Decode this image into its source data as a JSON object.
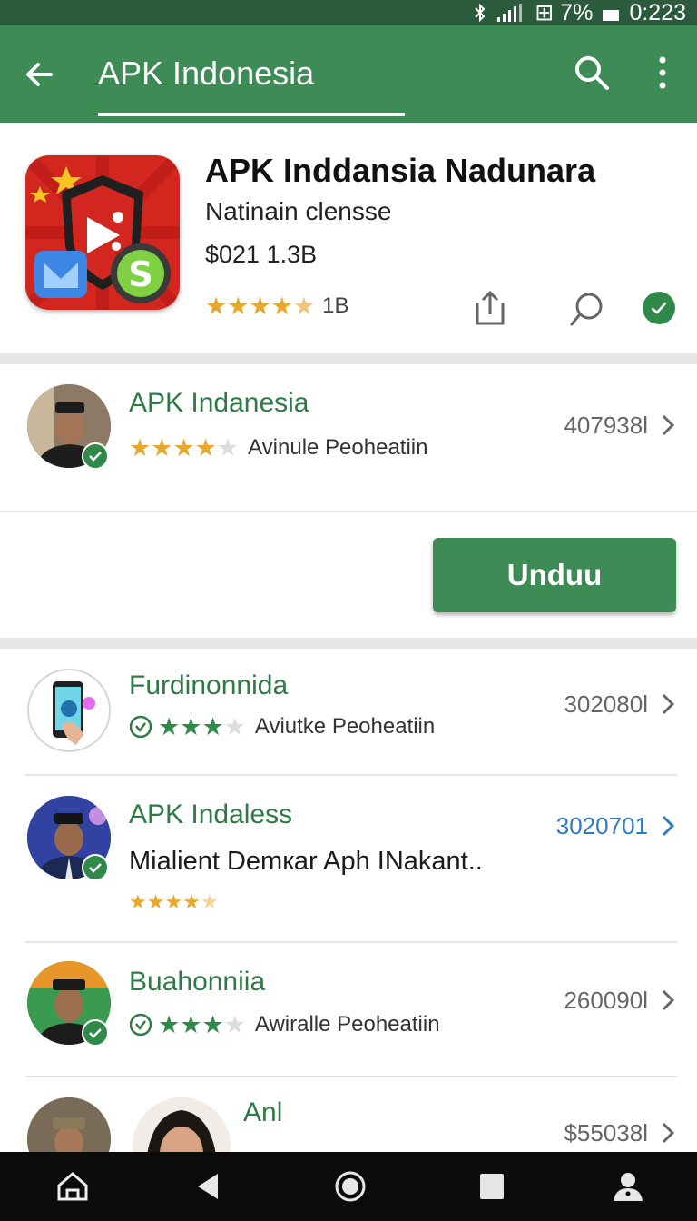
{
  "status_bar": {
    "battery": "⊞ 7%",
    "time": "0:223"
  },
  "app_bar": {
    "title": "APK Indonesia"
  },
  "hero": {
    "title": "APK Inddansia Nadunara",
    "subtitle": "Natinain clensse",
    "price": "$021 1.3B",
    "rating_count": "1B",
    "rating": 4.5
  },
  "listing1": {
    "title": "APK Indanesia",
    "subtitle": "Avinule Peoheatiin",
    "number": "407938l",
    "rating": 4
  },
  "download_button": {
    "label": "Unduu"
  },
  "list": [
    {
      "title": "Furdinonnida",
      "subtitle": "Aviutke Peoheatiin",
      "number": "302080l",
      "rating": 3
    },
    {
      "title": "APK Indaless",
      "subtitle": "Mialient Demкar Aph INakant..",
      "number": "3020701",
      "rating": 4
    },
    {
      "title": "Buahonniia",
      "subtitle": "Awiralle Peoheatiin",
      "number": "260090l",
      "rating": 3
    },
    {
      "title": "Anl",
      "number": "$55038l"
    }
  ],
  "colors": {
    "green": "#3d8b55",
    "dark_green": "#2b5b3c",
    "star_gold": "#e8a830",
    "link_blue": "#2f7ac4"
  },
  "icons": [
    "back-arrow-icon",
    "search-icon",
    "more-vert-icon",
    "share-icon",
    "chat-icon",
    "verified-icon",
    "chevron-right-icon",
    "home-icon",
    "back-nav-icon",
    "circle-home-icon",
    "square-recents-icon",
    "person-icon"
  ]
}
